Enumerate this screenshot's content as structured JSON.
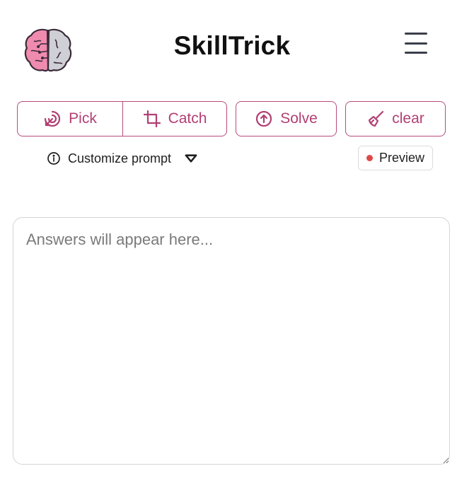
{
  "header": {
    "title": "SkillTrick",
    "logo_icon": "brain-icon",
    "menu_icon": "hamburger-menu-icon"
  },
  "toolbar": {
    "pick_label": "Pick",
    "catch_label": "Catch",
    "solve_label": "Solve",
    "clear_label": "clear"
  },
  "options": {
    "customize_label": "Customize prompt",
    "preview_label": "Preview"
  },
  "answers": {
    "value": "",
    "placeholder": "Answers will appear here..."
  },
  "colors": {
    "accent": "#b23f72",
    "accent_border": "#b94b7d",
    "preview_dot": "#e04848"
  }
}
